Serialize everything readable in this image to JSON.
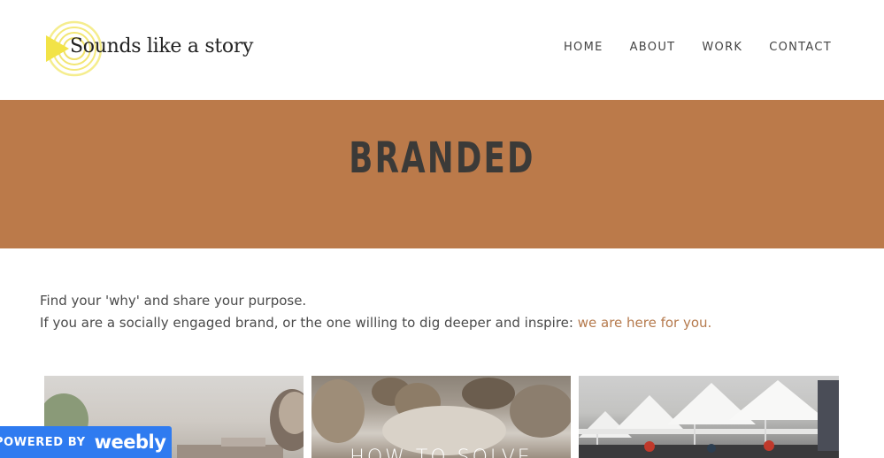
{
  "header": {
    "logo_text": "Sounds like a story",
    "nav": [
      {
        "label": "HOME"
      },
      {
        "label": "ABOUT"
      },
      {
        "label": "WORK"
      },
      {
        "label": "CONTACT"
      }
    ]
  },
  "banner": {
    "title": "BRANDED",
    "background": "#bb7a4a"
  },
  "intro": {
    "line1": "Find your 'why' and share your purpose.",
    "line2": "If you are a socially engaged brand, or the one willing to dig deeper and inspire: ",
    "link": "we are here for you."
  },
  "gallery": {
    "items": [
      {
        "overlay": ""
      },
      {
        "overlay": "HOW TO SOLVE"
      },
      {
        "overlay": ""
      }
    ]
  },
  "badge": {
    "powered_by": "POWERED BY",
    "brand": "weebly",
    "color": "#2f7bf0"
  },
  "colors": {
    "accent_link": "#b57a4d",
    "title_text": "#3b3a38"
  }
}
